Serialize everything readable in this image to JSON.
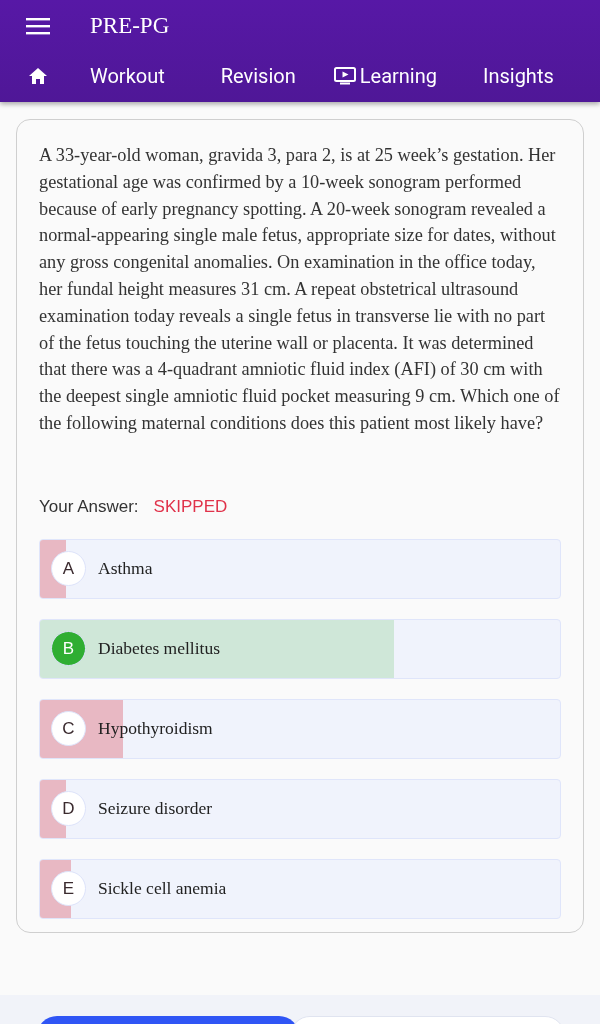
{
  "app_bar": {
    "title": "PRE-PG"
  },
  "tabs": [
    {
      "label": "Workout",
      "kind": "plain"
    },
    {
      "label": "Revision",
      "kind": "plain"
    },
    {
      "label": "Learning",
      "kind": "video"
    },
    {
      "label": "Insights",
      "kind": "plain"
    }
  ],
  "question": {
    "text": "A 33-year-old woman, gravida 3, para 2, is at 25 week’s gestation. Her gestational age was confirmed by a 10-week sonogram performed because of early pregnancy spotting. A 20-week sonogram revealed a normal-appearing single male fetus, appropriate size for dates, without any gross congenital anomalies. On examination in the office today, her fundal height measures 31 cm. A repeat obstetrical ultrasound examination today reveals a single fetus in transverse lie with no part of the fetus touching the uterine wall or placenta. It was determined that there was a 4-quadrant amniotic fluid index (AFI) of 30 cm with the deepest single amniotic fluid pocket measuring 9 cm. Which one of the following maternal conditions does this patient most likely have?"
  },
  "answer": {
    "label": "Your Answer:",
    "value": "SKIPPED"
  },
  "options": [
    {
      "letter": "A",
      "text": "Asthma",
      "correct": false,
      "level": 0.05
    },
    {
      "letter": "B",
      "text": "Diabetes mellitus",
      "correct": true,
      "level": 0.68
    },
    {
      "letter": "C",
      "text": "Hypothyroidism",
      "correct": false,
      "level": 0.16
    },
    {
      "letter": "D",
      "text": "Seizure disorder",
      "correct": false,
      "level": 0.05
    },
    {
      "letter": "E",
      "text": "Sickle cell anemia",
      "correct": false,
      "level": 0.06
    }
  ]
}
